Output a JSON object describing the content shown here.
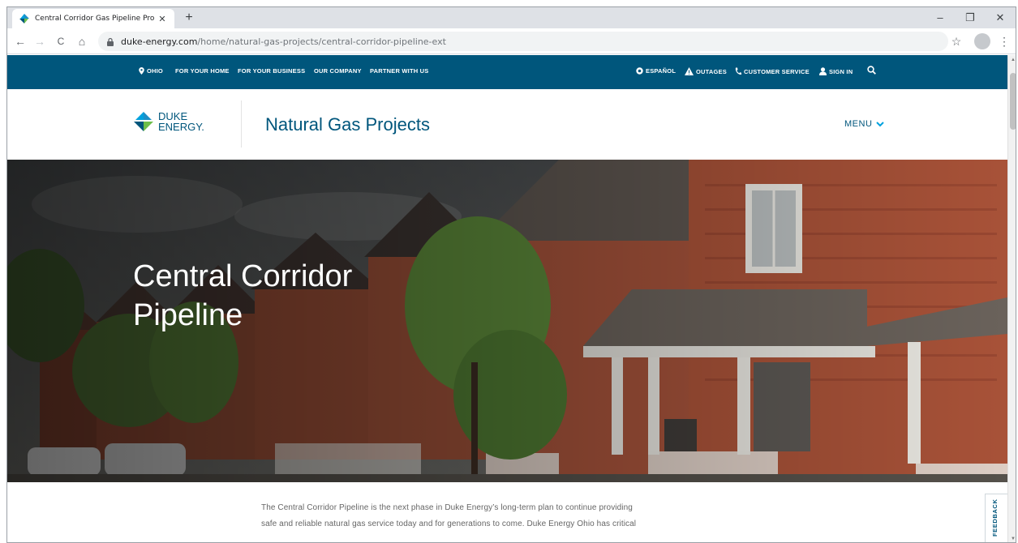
{
  "browser": {
    "tab_title": "Central Corridor Gas Pipeline Pro",
    "tab_close": "✕",
    "new_tab": "+",
    "window_controls": {
      "minimize": "–",
      "maximize": "❐",
      "close": "✕"
    },
    "nav": {
      "back": "←",
      "forward": "→",
      "reload": "C",
      "home": "⌂"
    },
    "url_host": "duke-energy.com",
    "url_path": "/home/natural-gas-projects/central-corridor-pipeline-ext",
    "bookmark": "☆",
    "menu": "⋮"
  },
  "topbar": {
    "location": "OHIO",
    "nav": [
      "FOR YOUR HOME",
      "FOR YOUR BUSINESS",
      "OUR COMPANY",
      "PARTNER WITH US"
    ],
    "language": "ESPAÑOL",
    "outages": "OUTAGES",
    "customer_service": "CUSTOMER SERVICE",
    "sign_in": "SIGN IN"
  },
  "header": {
    "logo_line1": "DUKE",
    "logo_line2": "ENERGY.",
    "site_title": "Natural Gas Projects",
    "menu_label": "MENU"
  },
  "hero": {
    "title_line1": "Central Corridor",
    "title_line2": "Pipeline"
  },
  "content": {
    "intro_line1": "The Central Corridor Pipeline is the next phase in Duke Energy’s long-term plan to continue providing",
    "intro_line2": "safe and reliable natural gas service today and for generations to come. Duke Energy Ohio has critical"
  },
  "feedback_label": "FEEDBACK",
  "colors": {
    "brand_blue": "#00567c",
    "brand_accent": "#00a1de",
    "brand_green": "#6ebe4a"
  }
}
